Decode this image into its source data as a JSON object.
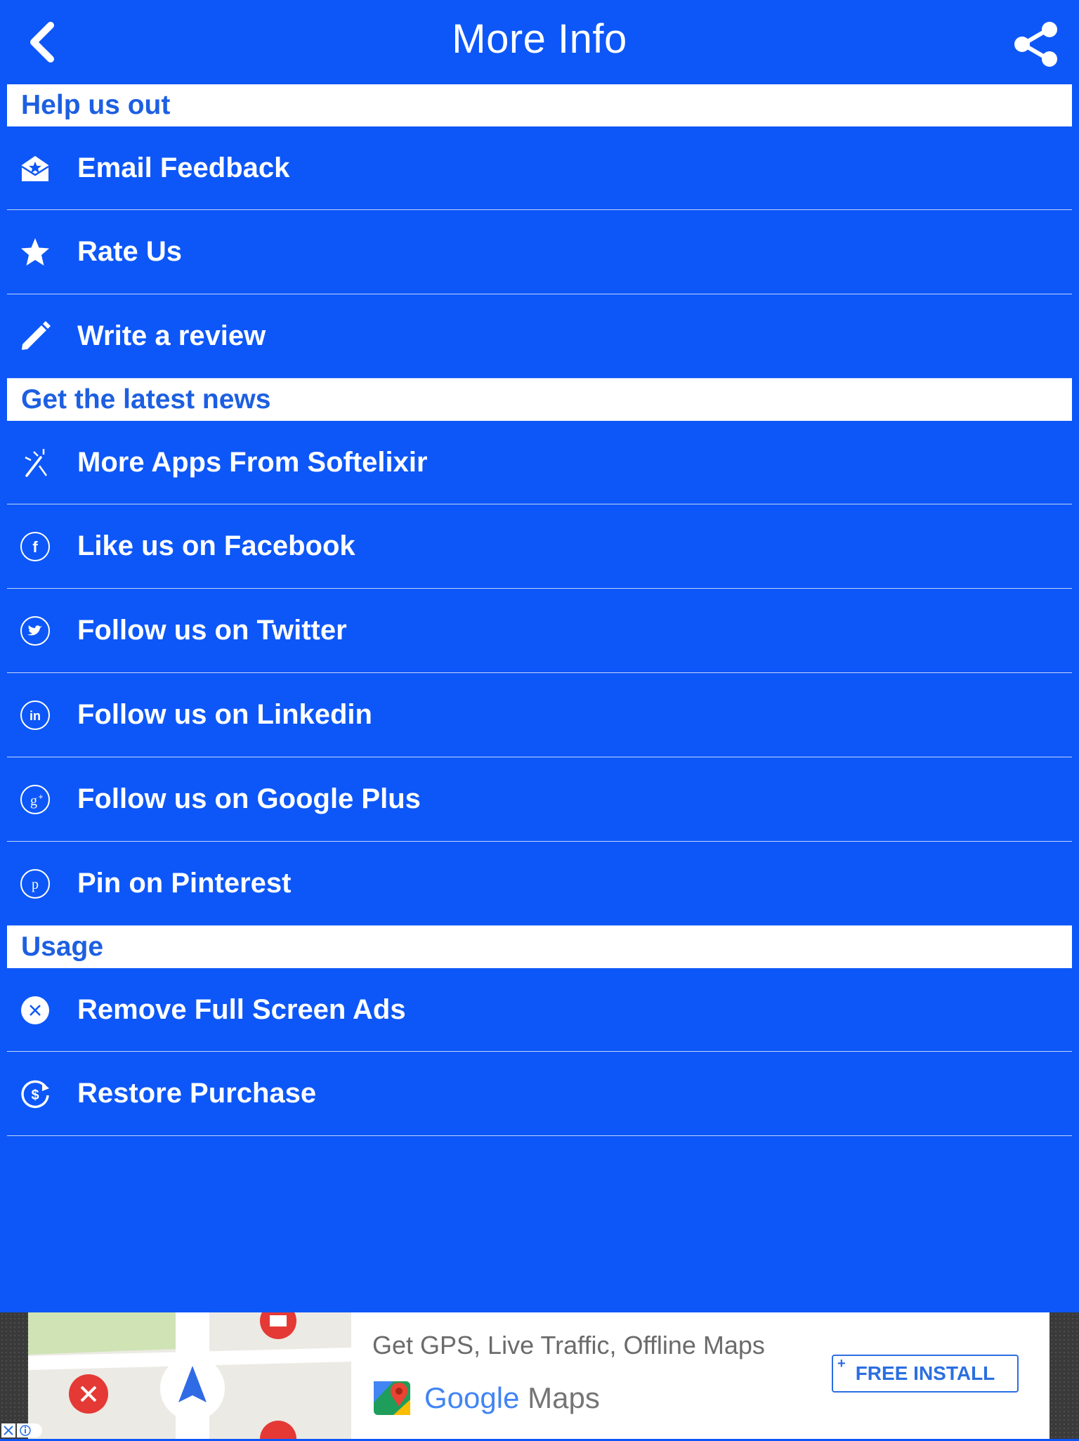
{
  "navbar": {
    "title": "More Info"
  },
  "sections": {
    "help": "Help us out",
    "news": "Get the latest news",
    "usage": "Usage"
  },
  "items": {
    "email_feedback": "Email Feedback",
    "rate_us": "Rate Us",
    "write_review": "Write a review",
    "more_apps": "More Apps From Softelixir",
    "facebook": "Like us on Facebook",
    "twitter": "Follow us on Twitter",
    "linkedin": "Follow us on Linkedin",
    "google_plus": "Follow us on Google Plus",
    "pinterest": "Pin on Pinterest",
    "remove_ads": "Remove Full Screen Ads",
    "restore_purchase": "Restore Purchase"
  },
  "ad": {
    "headline": "Get GPS, Live Traffic, Offline Maps",
    "brand_google": "Google",
    "brand_maps": "Maps",
    "cta": "FREE INSTALL"
  },
  "colors": {
    "background": "#0d57f8",
    "section_text": "#1d5fe2",
    "ad_cta": "#2b6fe0"
  }
}
